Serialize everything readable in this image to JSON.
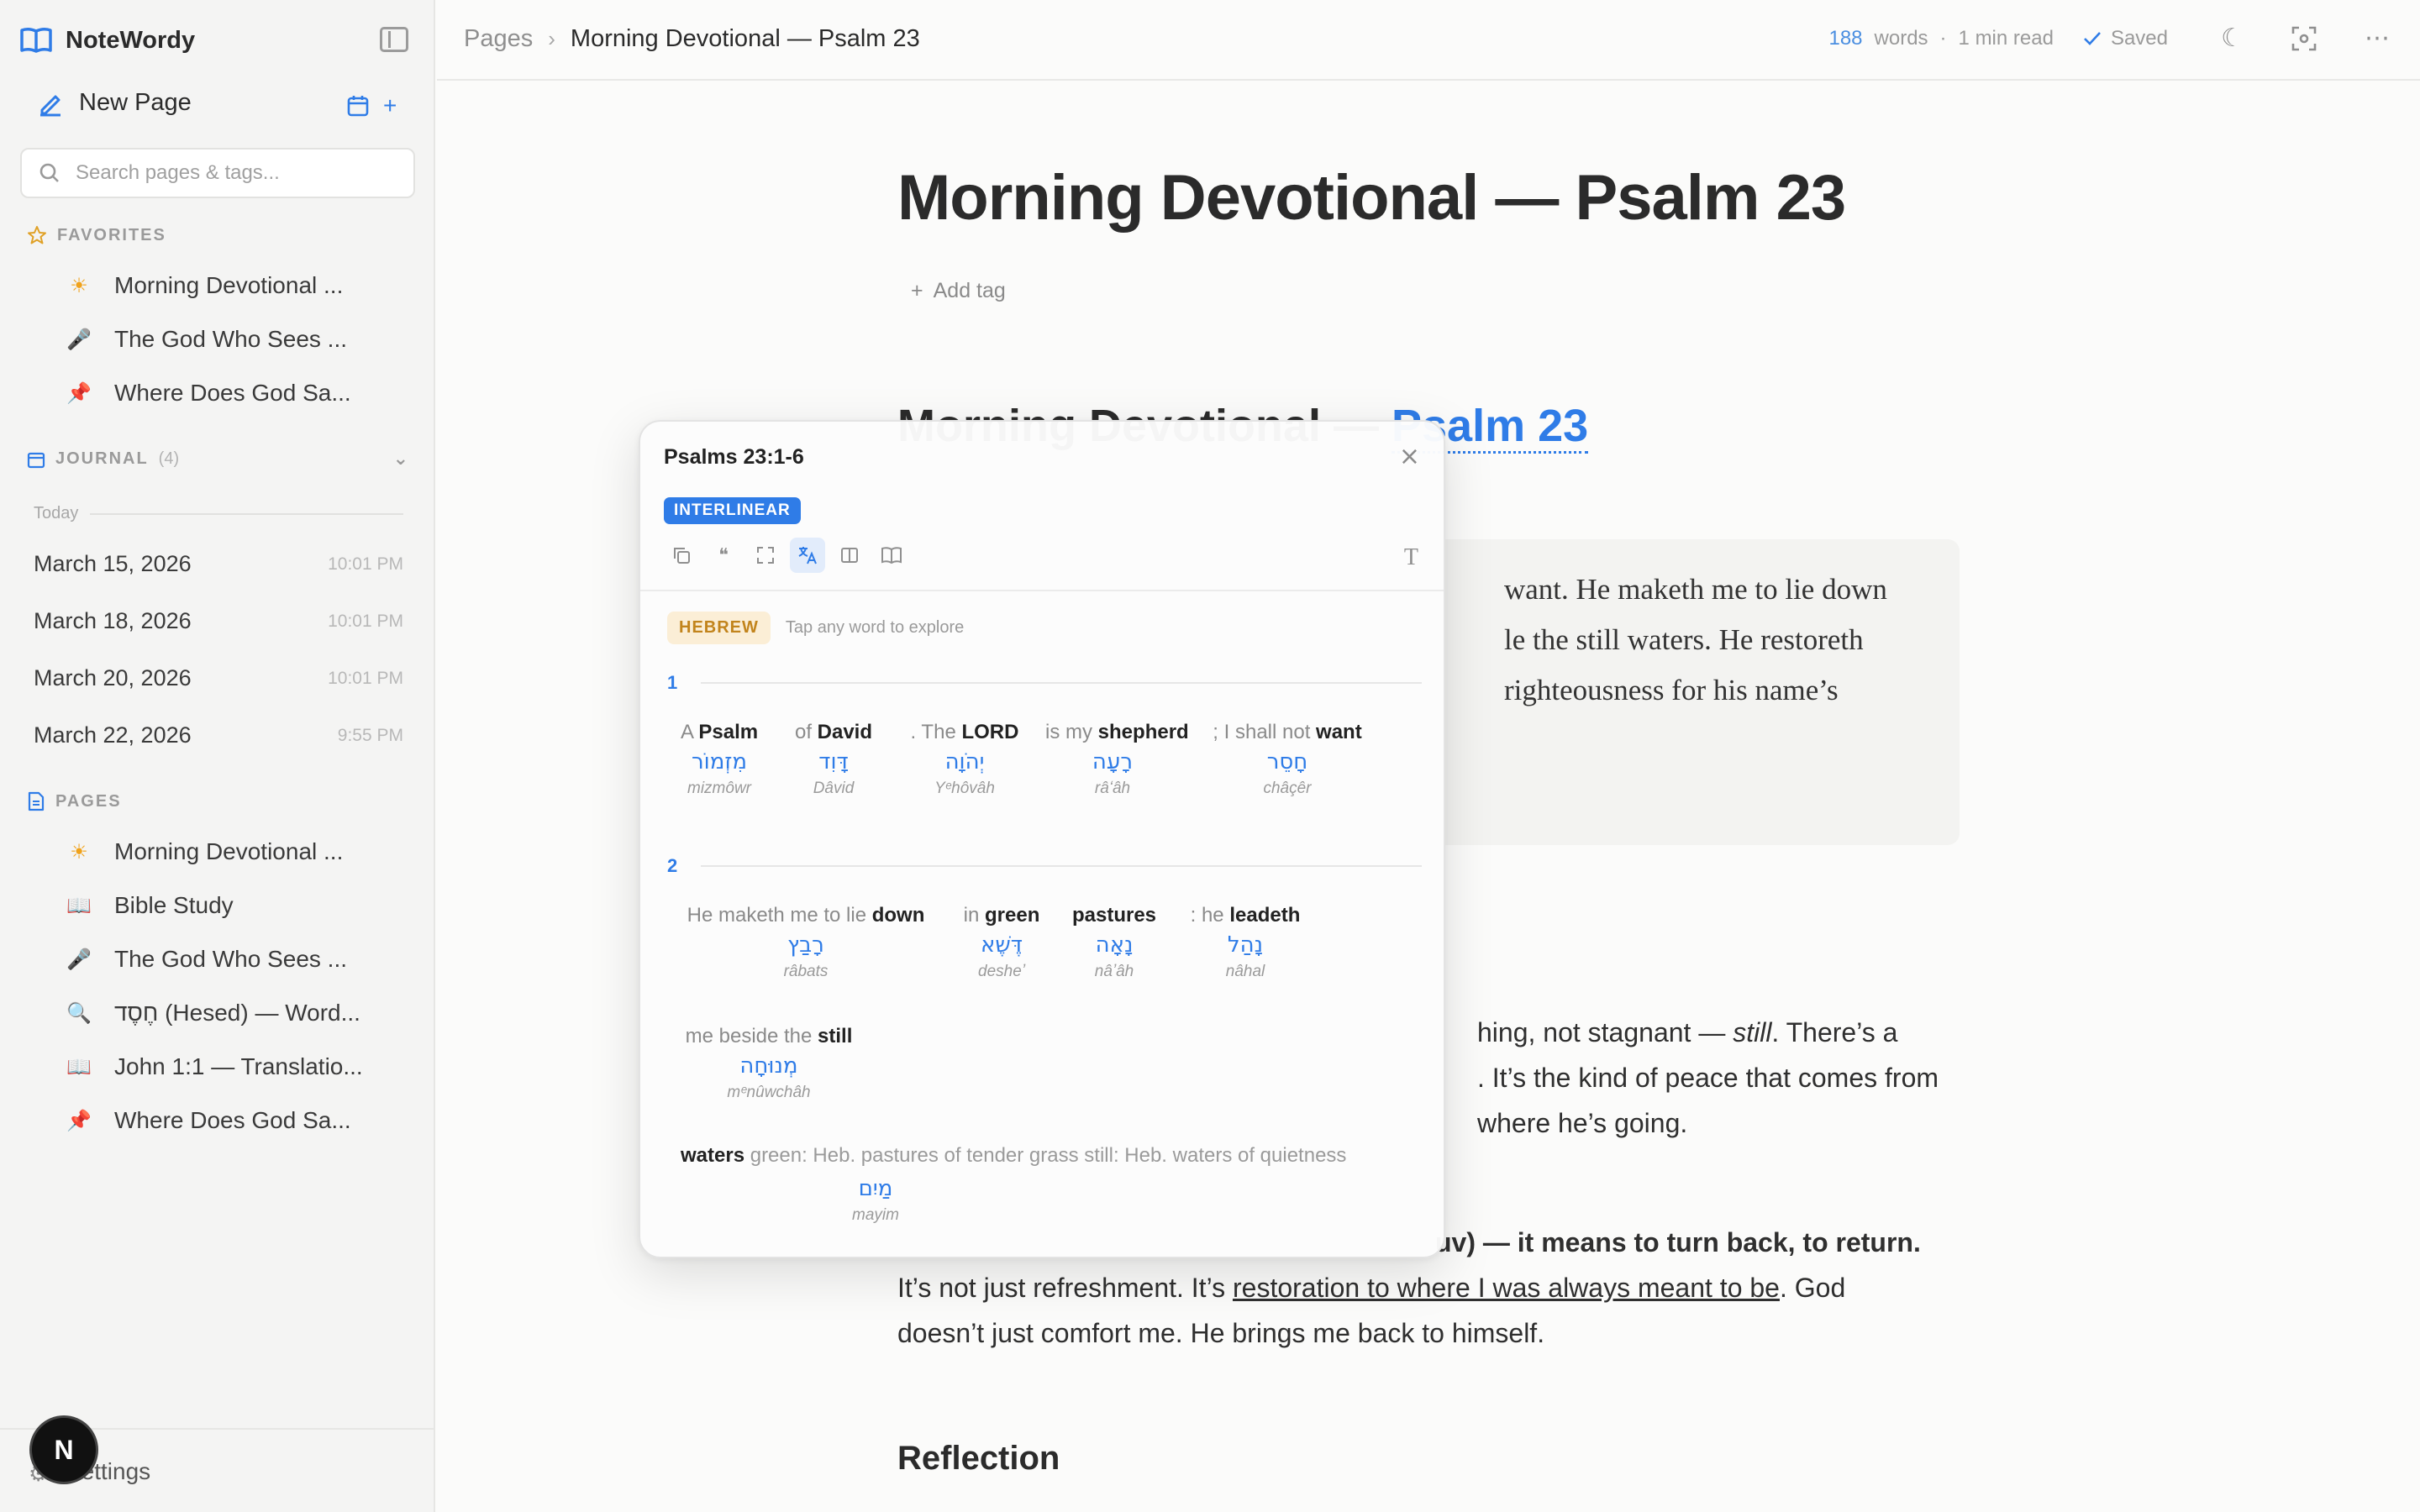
{
  "app": {
    "name": "NoteWordy"
  },
  "sidebar": {
    "new_page_label": "New Page",
    "search_placeholder": "Search pages & tags...",
    "favorites_label": "FAVORITES",
    "favorites": [
      {
        "emoji": "☀",
        "label": "Morning Devotional ..."
      },
      {
        "emoji": "🎤",
        "label": "The God Who Sees ..."
      },
      {
        "emoji": "📌",
        "label": "Where Does God Sa..."
      }
    ],
    "journal_label": "JOURNAL",
    "journal_count": "(4)",
    "today_label": "Today",
    "journal": [
      {
        "date": "March 15, 2026",
        "time": "10:01 PM"
      },
      {
        "date": "March 18, 2026",
        "time": "10:01 PM"
      },
      {
        "date": "March 20, 2026",
        "time": "10:01 PM"
      },
      {
        "date": "March 22, 2026",
        "time": "9:55 PM"
      }
    ],
    "pages_label": "PAGES",
    "pages": [
      {
        "emoji": "☀",
        "label": "Morning Devotional ..."
      },
      {
        "emoji": "📖",
        "label": "Bible Study"
      },
      {
        "emoji": "🎤",
        "label": "The God Who Sees ..."
      },
      {
        "emoji": "🔍",
        "label": "חֶסֶד (Hesed) — Word..."
      },
      {
        "emoji": "📖",
        "label": "John 1:1 — Translatio..."
      },
      {
        "emoji": "📌",
        "label": "Where Does God Sa..."
      }
    ],
    "settings_label": "Settings",
    "avatar_letter": "N"
  },
  "topbar": {
    "breadcrumb_root": "Pages",
    "breadcrumb_sep": "›",
    "breadcrumb_current": "Morning Devotional — Psalm 23",
    "word_count": "188",
    "words_label": "words",
    "dot": "·",
    "read_time": "1 min read",
    "saved_label": "Saved"
  },
  "doc": {
    "title": "Morning Devotional — Psalm 23",
    "add_tag": "Add tag",
    "heading_prefix": "Morning Devotional — ",
    "heading_link": "Psalm 23",
    "quote_lines": [
      "want. He maketh me to lie down",
      "le the still waters. He restoreth",
      "righteousness for his name’s"
    ],
    "para1_lines": [
      "hing, not stagnant — ",
      "still",
      ". There’s a",
      ". It’s the kind of peace that comes from",
      "where he’s going."
    ],
    "para2_line1": "uv) — it means to turn back, to return.",
    "para2_line2_a": "It’s not just refreshment. It’s ",
    "para2_line2_link": "restoration to where I was always meant to be",
    "para2_line2_b": ". God",
    "para2_line3": "doesn’t just comfort me. He brings me back to himself.",
    "reflection_heading": "Reflection"
  },
  "popup": {
    "title": "Psalms 23:1-6",
    "mode": "INTERLINEAR",
    "language": "HEBREW",
    "hint": "Tap any word to explore",
    "verses": [
      {
        "number": "1",
        "words": [
          {
            "pre": "A ",
            "word": "Psalm",
            "hebrew": "מִזְמוֹר",
            "translit": "mizmôwr"
          },
          {
            "pre": "of ",
            "word": "David",
            "hebrew": "דָּוִד",
            "translit": "Dâvid"
          },
          {
            "pre": ". The ",
            "word": "LORD",
            "hebrew": "יְהֹוָה",
            "translit": "Yᵉhôvâh"
          },
          {
            "pre": "is my ",
            "word": "shepherd",
            "hebrew": "רָעָה",
            "translit": "râʻâh"
          },
          {
            "pre": "; I shall not ",
            "word": "want",
            "hebrew": "חָסֵר",
            "translit": "châçêr"
          }
        ]
      },
      {
        "number": "2",
        "words": [
          {
            "pre": "He maketh me to lie ",
            "word": "down",
            "hebrew": "רָבַץ",
            "translit": "râbats"
          },
          {
            "pre": "in ",
            "word": "green",
            "hebrew": "דֶּשֶׁא",
            "translit": "desheʼ"
          },
          {
            "pre": "",
            "word": "pastures",
            "hebrew": "נָאָה",
            "translit": "nâʼâh"
          },
          {
            "pre": ": he ",
            "word": "leadeth",
            "hebrew": "נָהַל",
            "translit": "nâhal"
          },
          {
            "pre": "me beside the ",
            "word": "still",
            "hebrew": "מְנוּחָה",
            "translit": "mᵉnûwchâh"
          }
        ],
        "note_word": "waters",
        "note_text": " green: Heb. pastures of tender grass still: Heb. waters of quietness",
        "note_hebrew": "מַיִם",
        "note_translit": "mayim"
      }
    ]
  }
}
